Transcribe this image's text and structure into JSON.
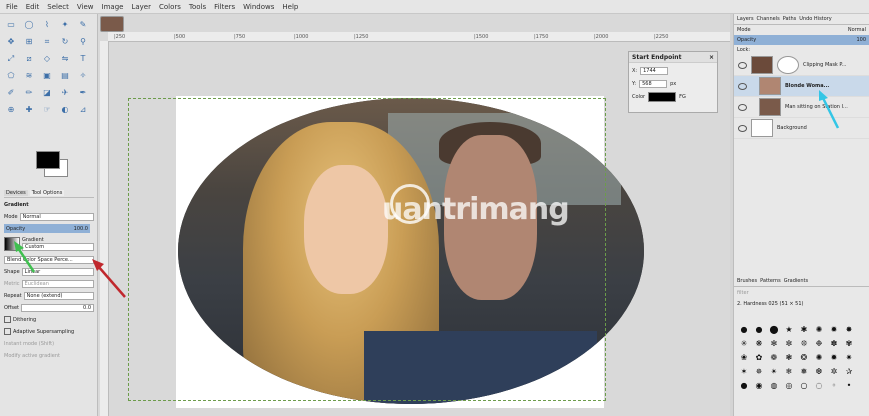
{
  "menu": [
    "File",
    "Edit",
    "Select",
    "View",
    "Image",
    "Layer",
    "Colors",
    "Tools",
    "Filters",
    "Windows",
    "Help"
  ],
  "ruler": [
    "|250",
    "|500",
    "|750",
    "|1000",
    "|1250",
    "|1500",
    "|1750",
    "|2000",
    "|2250"
  ],
  "tool_options": {
    "tabs": [
      "Devices",
      "Tool Options"
    ],
    "title": "Gradient",
    "mode_label": "Mode",
    "mode_value": "Normal",
    "opacity_label": "Opacity",
    "opacity_value": "100.0",
    "gradient_label": "Gradient",
    "gradient_value": "Custom",
    "blend_label": "Blend Color Space Perce...",
    "shape_label": "Shape",
    "shape_value": "Linear",
    "metric_label": "Metric",
    "metric_value": "Euclidean",
    "repeat_label": "Repeat",
    "repeat_value": "None (extend)",
    "offset_label": "Offset",
    "offset_value": "0.0",
    "dithering": "Dithering",
    "adaptive": "Adaptive Supersampling",
    "instant": "Instant mode (Shift)",
    "modify": "Modify active gradient"
  },
  "start_endpoint": {
    "title": "Start Endpoint",
    "x_label": "X:",
    "x_value": "1744",
    "y_label": "Y:",
    "y_value": "568",
    "unit": "px",
    "color_label": "Color",
    "color_value": "FG"
  },
  "right_panel": {
    "tabs": [
      "Layers",
      "Channels",
      "Paths",
      "Undo History"
    ],
    "mode_label": "Mode",
    "mode_value": "Normal",
    "opacity_label": "Opacity",
    "opacity_value": "100",
    "lock_label": "Lock:",
    "layers": [
      {
        "name": "Clipping Mask P..."
      },
      {
        "name": "Blonde Woma..."
      },
      {
        "name": "Man sitting on Station I..."
      },
      {
        "name": "Background"
      }
    ],
    "brush_tabs": [
      "Brushes",
      "Patterns",
      "Gradients"
    ],
    "brush_filter": "filter",
    "brush_name": "2. Hardness 025 (51 × 51)"
  },
  "watermark": "uantrimang",
  "colors": {
    "fg": "#000000",
    "bg": "#ffffff",
    "selected": "#8fb0d6",
    "guide": "#6c9c4a",
    "arrow_red": "#c0282d",
    "arrow_green": "#3fbf4f",
    "arrow_cyan": "#33c6e6"
  }
}
